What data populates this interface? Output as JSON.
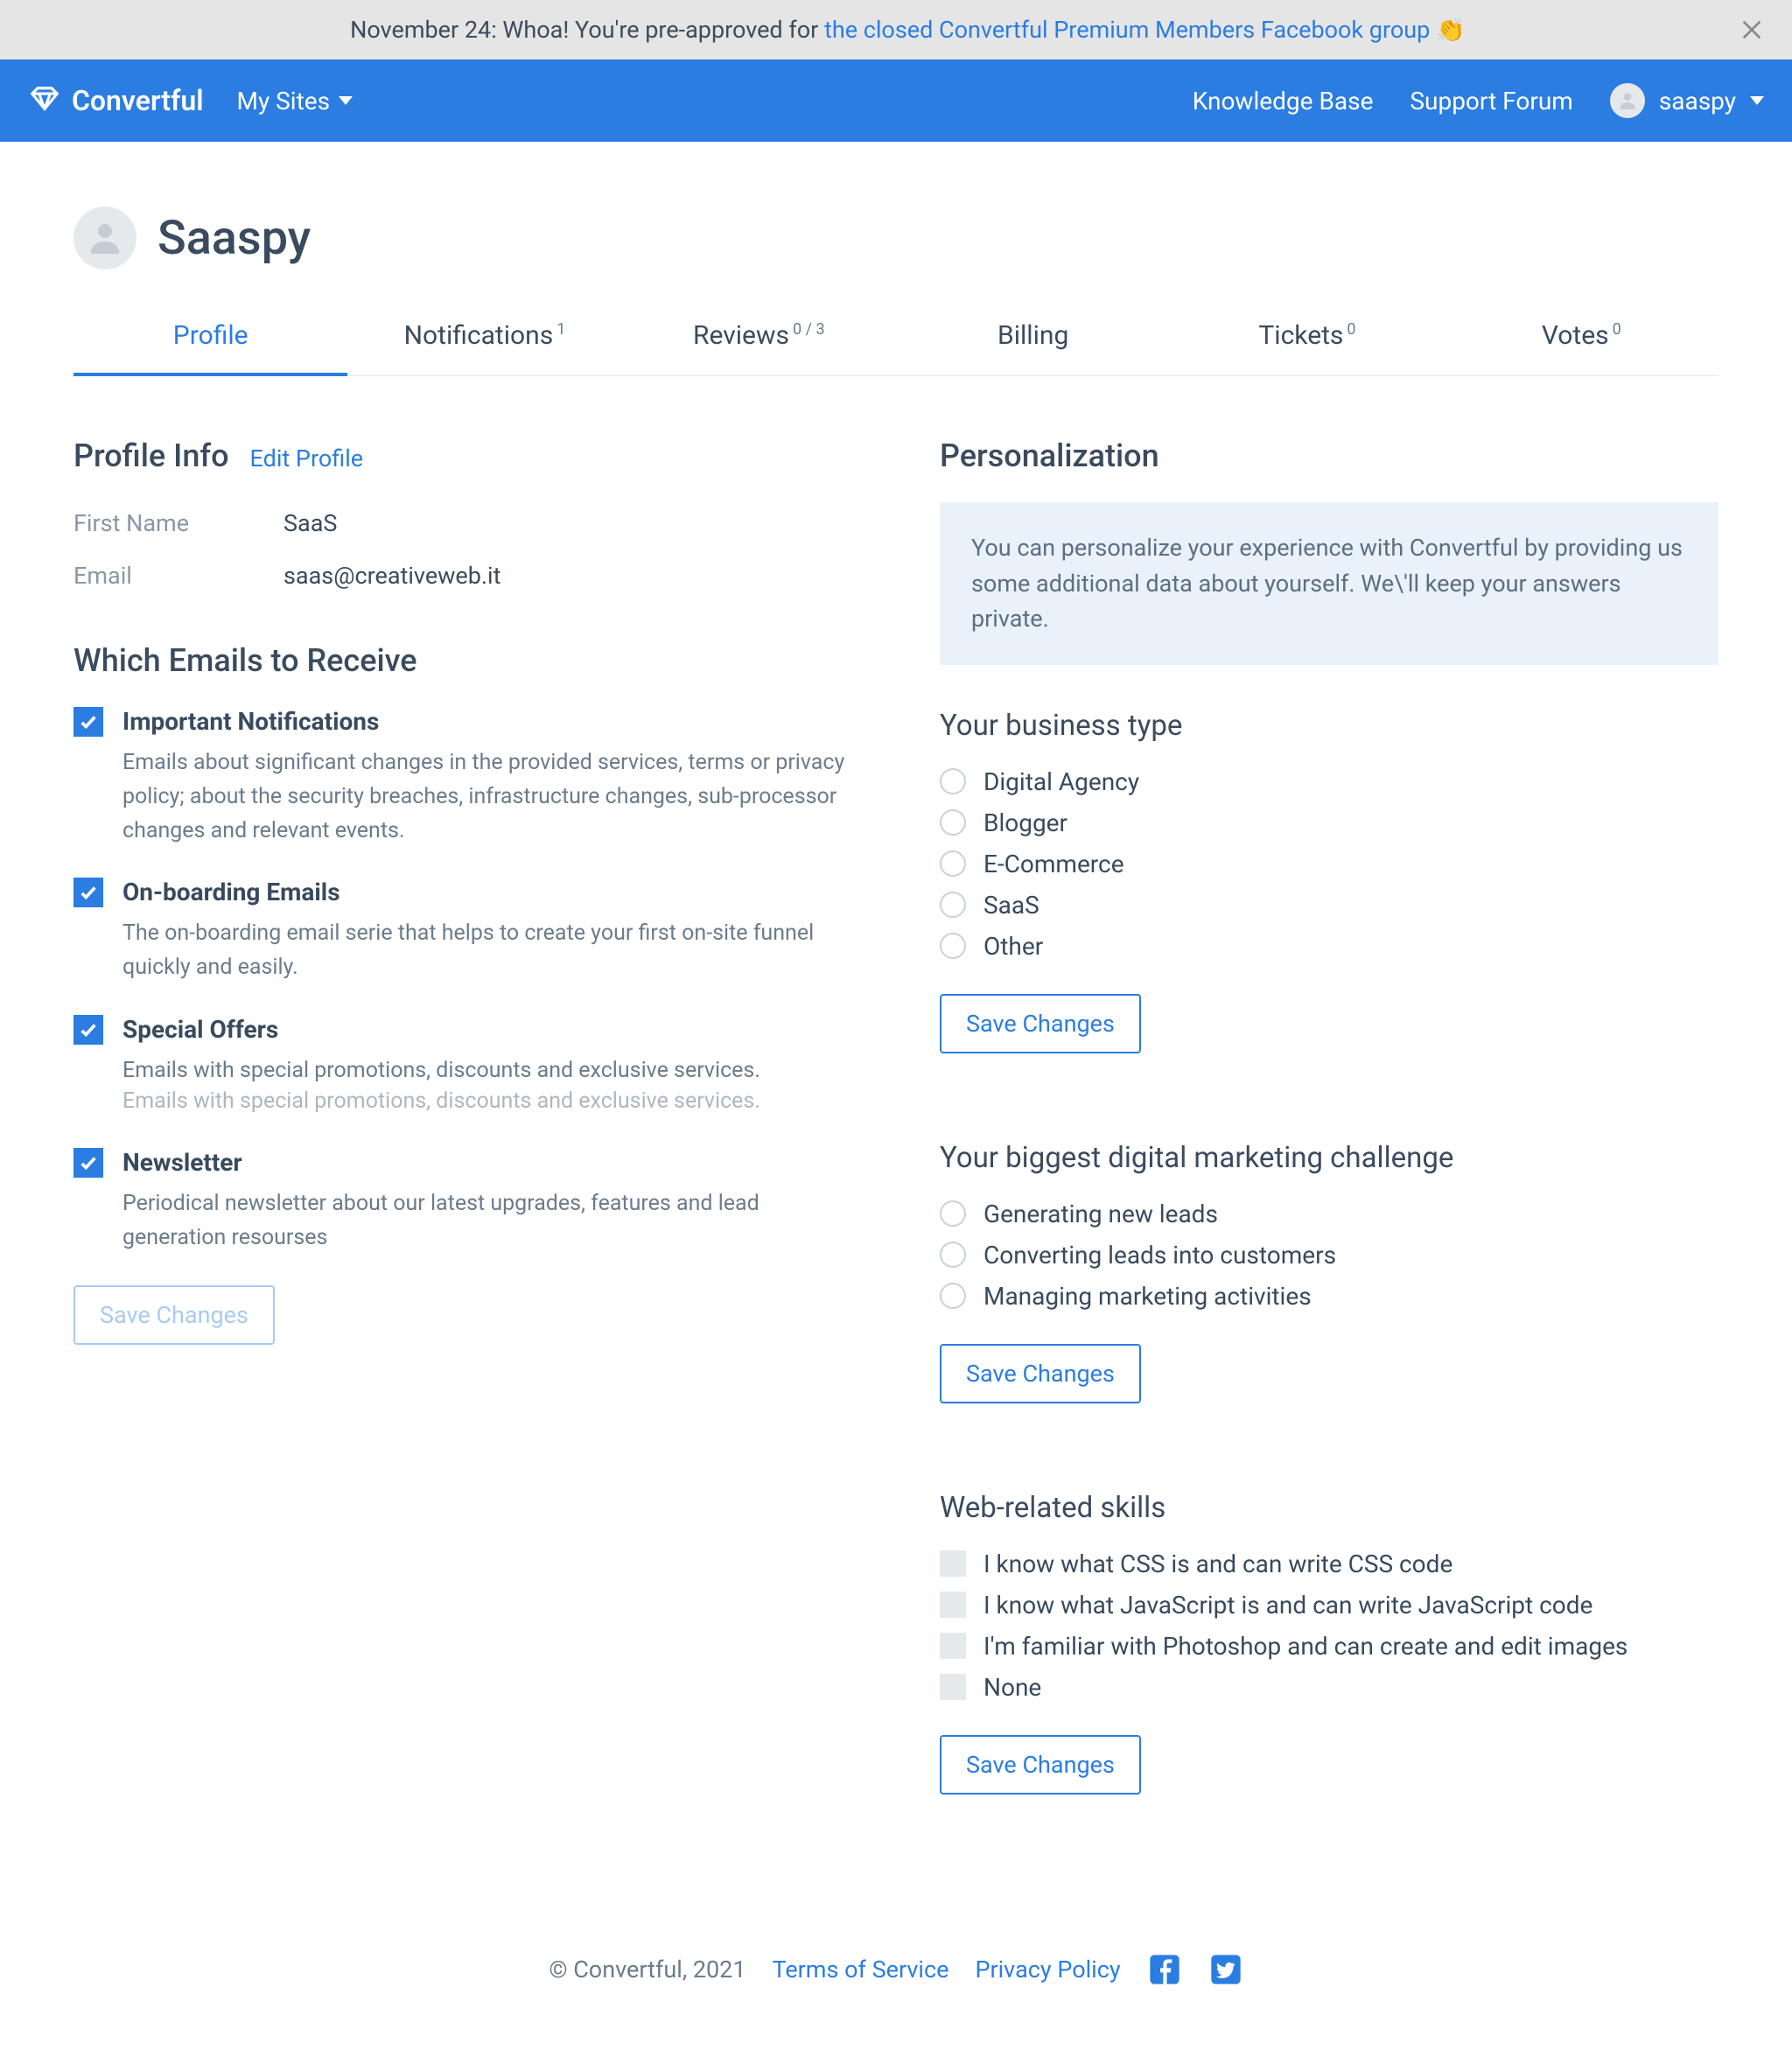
{
  "banner": {
    "prefix": "November 24: Whoa! You're pre-approved for ",
    "link": "the closed Convertful Premium Members Facebook group",
    "emoji": " 👏"
  },
  "nav": {
    "brand": "Convertful",
    "my_sites": "My Sites",
    "knowledge_base": "Knowledge Base",
    "support_forum": "Support Forum",
    "user": "saaspy"
  },
  "user": {
    "display_name": "Saaspy"
  },
  "tabs": {
    "profile": "Profile",
    "notifications": "Notifications",
    "notifications_sup": "1",
    "reviews": "Reviews",
    "reviews_sup": "0 / 3",
    "billing": "Billing",
    "tickets": "Tickets",
    "tickets_sup": "0",
    "votes": "Votes",
    "votes_sup": "0"
  },
  "profile_info": {
    "heading": "Profile Info",
    "edit": "Edit Profile",
    "first_name_label": "First Name",
    "first_name_value": "SaaS",
    "email_label": "Email",
    "email_value": "saas@creativeweb.it"
  },
  "emails": {
    "heading": "Which Emails to Receive",
    "important": {
      "title": "Important Notifications",
      "desc": "Emails about significant changes in the provided services, terms or privacy policy; about the security breaches, infrastructure changes, sub-processor changes and relevant events."
    },
    "onboarding": {
      "title": "On-boarding Emails",
      "desc": "The on-boarding email serie that helps to create your first on-site funnel quickly and easily."
    },
    "offers": {
      "title": "Special Offers",
      "desc": "Emails with special promotions, discounts and exclusive services."
    },
    "offers_dup_desc": "Emails with special promotions, discounts and exclusive services.",
    "newsletter": {
      "title": "Newsletter",
      "desc": "Periodical newsletter about our latest upgrades, features and lead generation resourses"
    },
    "save": "Save Changes"
  },
  "personalization": {
    "heading": "Personalization",
    "notice": "You can personalize your experience with Convertful by providing us some additional data about yourself. We\\'ll keep your answers private.",
    "business": {
      "heading": "Your business type",
      "options": [
        "Digital Agency",
        "Blogger",
        "E-Commerce",
        "SaaS",
        "Other"
      ],
      "save": "Save Changes"
    },
    "challenge": {
      "heading": "Your biggest digital marketing challenge",
      "options": [
        "Generating new leads",
        "Converting leads into customers",
        "Managing marketing activities"
      ],
      "save": "Save Changes"
    },
    "skills": {
      "heading": "Web-related skills",
      "options": [
        "I know what CSS is and can write CSS code",
        "I know what JavaScript is and can write JavaScript code",
        "I'm familiar with Photoshop and can create and edit images",
        "None"
      ],
      "save": "Save Changes"
    }
  },
  "footer": {
    "copyright": "© Convertful, 2021",
    "terms": "Terms of Service",
    "privacy": "Privacy Policy"
  }
}
